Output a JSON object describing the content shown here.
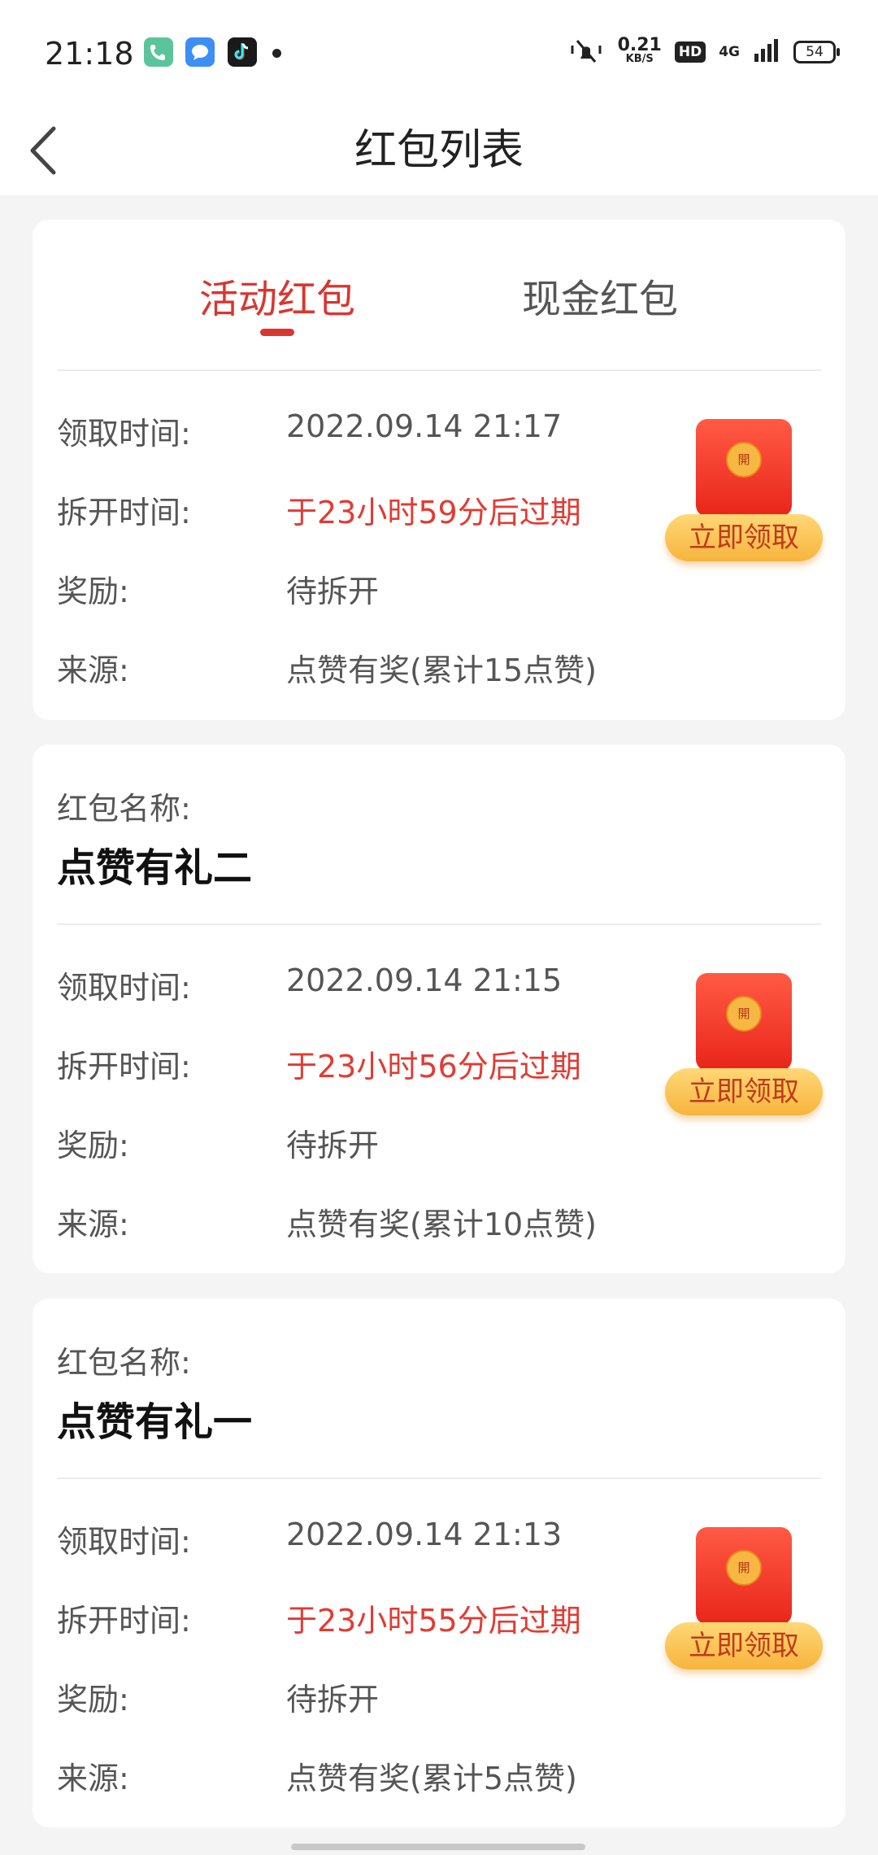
{
  "status_bar": {
    "time": "21:18",
    "net_speed_value": "0.21",
    "net_speed_unit": "KB/S",
    "hd_label": "HD",
    "network_label": "4G",
    "battery_level": "54",
    "app_icons": [
      "phone-app-icon",
      "message-app-icon",
      "tiktok-app-icon"
    ]
  },
  "header": {
    "title": "红包列表",
    "back_icon": "chevron-left-icon"
  },
  "tabs": [
    {
      "label": "活动红包",
      "active": true
    },
    {
      "label": "现金红包",
      "active": false
    }
  ],
  "labels": {
    "name_label": "红包名称:",
    "receive_time": "领取时间:",
    "open_time": "拆开时间:",
    "reward": "奖励:",
    "source": "来源:",
    "claim_button": "立即领取",
    "seal_char": "開"
  },
  "cards": [
    {
      "name": "",
      "receive_time": "2022.09.14 21:17",
      "open_time": "于23小时59分后过期",
      "reward": "待拆开",
      "source": "点赞有奖(累计15点赞)"
    },
    {
      "name": "点赞有礼二",
      "receive_time": "2022.09.14 21:15",
      "open_time": "于23小时56分后过期",
      "reward": "待拆开",
      "source": "点赞有奖(累计10点赞)"
    },
    {
      "name": "点赞有礼一",
      "receive_time": "2022.09.14 21:13",
      "open_time": "于23小时55分后过期",
      "reward": "待拆开",
      "source": "点赞有奖(累计5点赞)"
    }
  ],
  "colors": {
    "accent_red": "#d9362f",
    "expire_red": "#e23b32",
    "button_gold": "#f7b43d"
  }
}
